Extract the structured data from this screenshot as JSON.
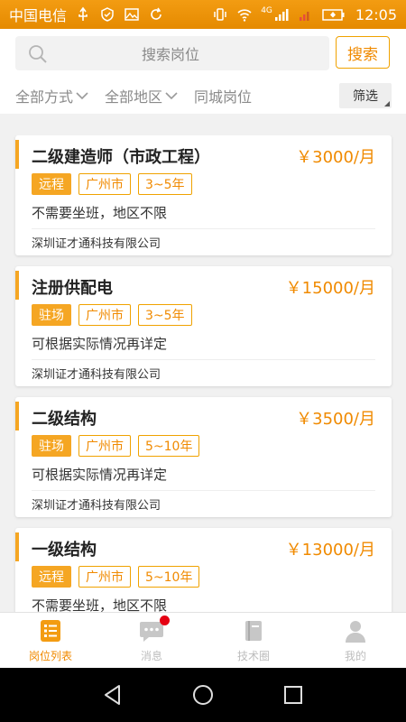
{
  "status_bar": {
    "carrier": "中国电信",
    "network_label": "4G",
    "time": "12:05"
  },
  "search": {
    "placeholder": "搜索岗位",
    "button_label": "搜索"
  },
  "filters": {
    "items": [
      "全部方式",
      "全部地区",
      "同城岗位"
    ],
    "screen_label": "筛选"
  },
  "jobs": [
    {
      "title": "二级建造师（市政工程）",
      "salary": "￥3000/月",
      "mode": "远程",
      "city": "广州市",
      "experience": "3~5年",
      "desc": "不需要坐班，地区不限",
      "company": "深圳证才通科技有限公司"
    },
    {
      "title": "注册供配电",
      "salary": "￥15000/月",
      "mode": "驻场",
      "city": "广州市",
      "experience": "3~5年",
      "desc": "可根据实际情况再详定",
      "company": "深圳证才通科技有限公司"
    },
    {
      "title": "二级结构",
      "salary": "￥3500/月",
      "mode": "驻场",
      "city": "广州市",
      "experience": "5~10年",
      "desc": "可根据实际情况再详定",
      "company": "深圳证才通科技有限公司"
    },
    {
      "title": "一级结构",
      "salary": "￥13000/月",
      "mode": "远程",
      "city": "广州市",
      "experience": "5~10年",
      "desc": "不需要坐班，地区不限",
      "company": ""
    }
  ],
  "bottom_nav": {
    "items": [
      {
        "label": "岗位列表",
        "icon": "list-icon"
      },
      {
        "label": "消息",
        "icon": "chat-icon"
      },
      {
        "label": "技术圈",
        "icon": "book-icon"
      },
      {
        "label": "我的",
        "icon": "user-icon"
      }
    ]
  },
  "colors": {
    "accent": "#f08a00",
    "status_bar": "#f39c12",
    "badge": "#e50012"
  }
}
